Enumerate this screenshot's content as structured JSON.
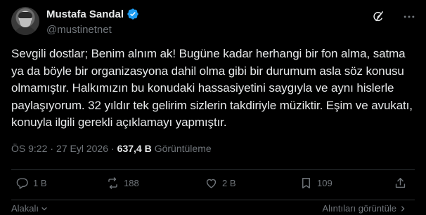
{
  "author": {
    "display_name": "Mustafa Sandal",
    "handle": "@mustinetnet",
    "verified_icon": "verified-badge-icon"
  },
  "post": {
    "text": "Sevgili dostlar; Benim alnım ak! Bugüne kadar herhangi bir fon alma, satma ya da böyle bir organizasyona dahil olma gibi bir durumum asla söz konusu olmamıştır. Halkımızın bu konudaki hassasiyetini saygıyla ve aynı hislerle paylaşıyorum. 32 yıldır tek gelirim sizlerin takdiriyle müziktir. Eşim ve avukatı, konuyla ilgili gerekli açıklamayı yapmıştır."
  },
  "meta": {
    "time": "ÖS 9:22",
    "separator": "·",
    "date": "27 Eyl 2026",
    "views_count": "637,4 B",
    "views_label": "Görüntüleme"
  },
  "actions": {
    "replies": "1 B",
    "reposts": "188",
    "likes": "2 B",
    "bookmarks": "109"
  },
  "footer": {
    "related_label": "Alakalı",
    "quotes_label": "Alıntıları görüntüle"
  },
  "colors": {
    "background": "#000000",
    "text_primary": "#e7e9ea",
    "text_secondary": "#71767b",
    "verified_blue": "#1d9bf0",
    "divider": "#2f3336"
  }
}
